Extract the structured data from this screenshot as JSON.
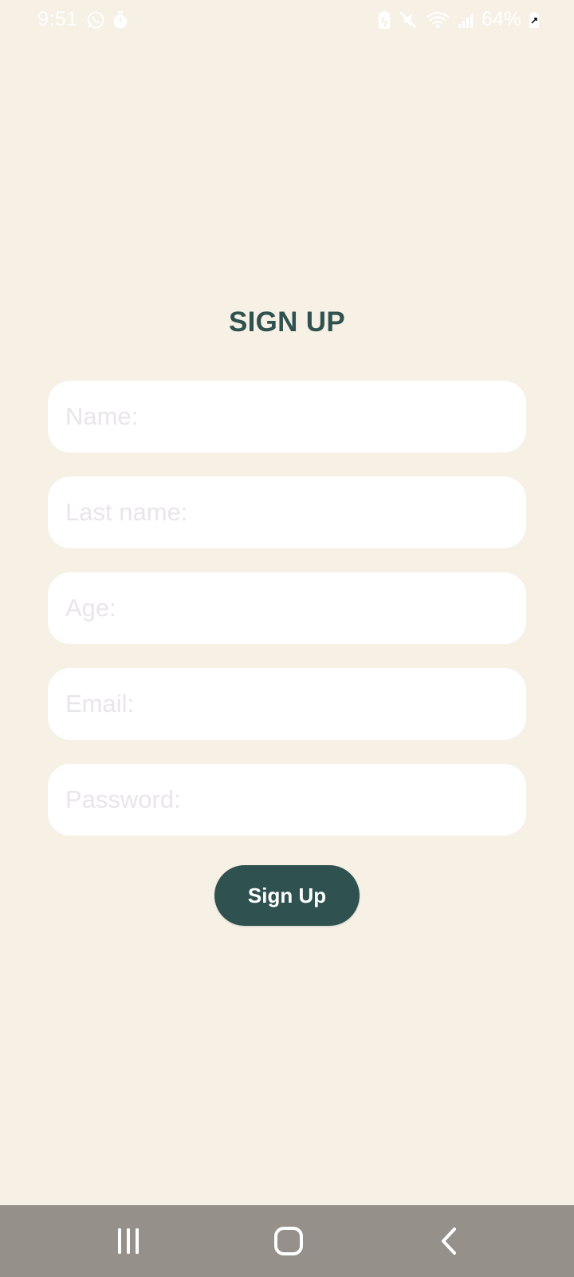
{
  "status_bar": {
    "time": "9:51",
    "battery": "64%",
    "icons": [
      "whatsapp-icon",
      "timer-icon",
      "battery-saver-icon",
      "mute-icon",
      "wifi-icon",
      "signal-icon",
      "battery-icon"
    ]
  },
  "signup": {
    "title": "SIGN UP",
    "fields": {
      "name": {
        "placeholder": "Name:",
        "value": ""
      },
      "last_name": {
        "placeholder": "Last name:",
        "value": ""
      },
      "age": {
        "placeholder": "Age:",
        "value": ""
      },
      "email": {
        "placeholder": "Email:",
        "value": ""
      },
      "password": {
        "placeholder": "Password:",
        "value": ""
      }
    },
    "button_label": "Sign Up"
  },
  "nav_bar": {
    "items": [
      "recent-apps-icon",
      "home-icon",
      "back-icon"
    ]
  },
  "colors": {
    "background": "#f6f0e5",
    "accent": "#2f5150",
    "field_background": "#ffffff",
    "placeholder": "#e9e5ea",
    "nav_bar": "#95918a"
  }
}
